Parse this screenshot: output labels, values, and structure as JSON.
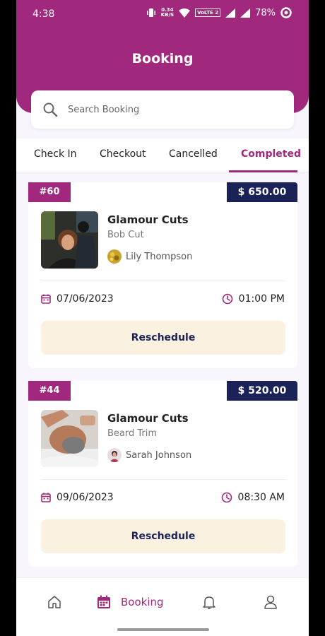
{
  "status_bar": {
    "time": "4:38",
    "speed_value": "0.34",
    "speed_unit": "KB/S",
    "network": "VoLTE 2",
    "battery": "78%"
  },
  "header": {
    "title": "Booking"
  },
  "search": {
    "placeholder": "Search Booking"
  },
  "tabs": [
    {
      "label": "Check In"
    },
    {
      "label": "Checkout"
    },
    {
      "label": "Cancelled"
    },
    {
      "label": "Completed",
      "active": true
    }
  ],
  "bookings": [
    {
      "id": "#60",
      "price": "$ 650.00",
      "salon": "Glamour Cuts",
      "service": "Bob Cut",
      "client": "Lily Thompson",
      "date": "07/06/2023",
      "time": "01:00 PM",
      "action": "Reschedule"
    },
    {
      "id": "#44",
      "price": "$ 520.00",
      "salon": "Glamour Cuts",
      "service": "Beard Trim",
      "client": "Sarah Johnson",
      "date": "09/06/2023",
      "time": "08:30 AM",
      "action": "Reschedule"
    }
  ],
  "bottom_nav": {
    "items": [
      {
        "icon": "home-icon"
      },
      {
        "icon": "calendar-icon",
        "label": "Booking",
        "active": true
      },
      {
        "icon": "bell-icon"
      },
      {
        "icon": "user-icon"
      }
    ]
  },
  "colors": {
    "primary": "#a0297e",
    "navy": "#1b2257",
    "cream": "#fbf1e1"
  }
}
